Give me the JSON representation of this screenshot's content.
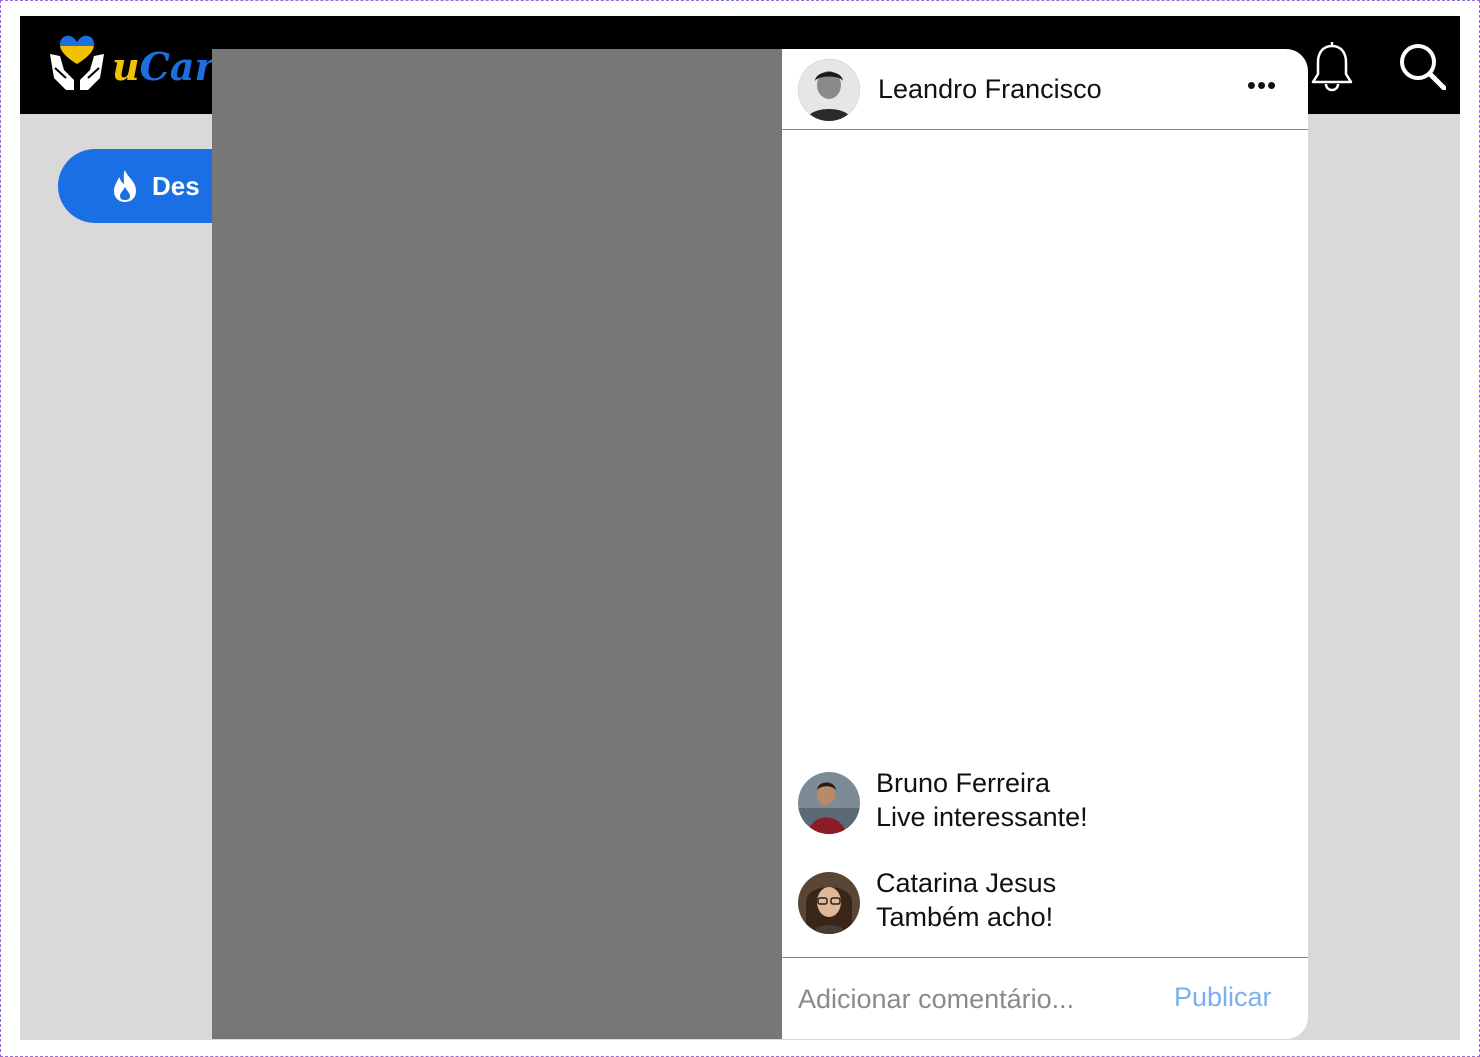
{
  "topbar": {
    "brand_prefix": "u",
    "brand_rest": "Car",
    "logo_icon": "heart-hands-icon",
    "notification_icon": "bell-icon",
    "search_icon": "search-icon"
  },
  "pill": {
    "label": "Des",
    "icon": "flame-icon"
  },
  "post": {
    "author": "Leandro Francisco",
    "more_label": "•••"
  },
  "comments": [
    {
      "name": "Bruno Ferreira",
      "text": "Live interessante!"
    },
    {
      "name": "Catarina Jesus",
      "text": "Também acho!"
    }
  ],
  "composer": {
    "placeholder": "Adicionar comentário...",
    "publish_label": "Publicar"
  },
  "colors": {
    "topbar": "#000000",
    "background": "#d9d9d9",
    "accent": "#1a6fe4",
    "publish": "#7ab0ef",
    "video_placeholder": "#777777"
  }
}
